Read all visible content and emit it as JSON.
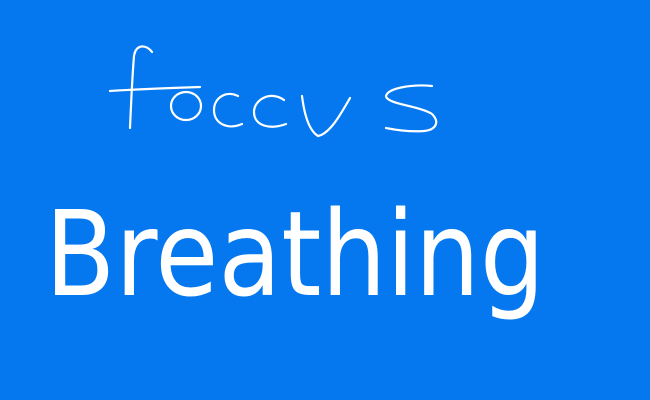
{
  "background_color": "#0578f0",
  "ink_color": "#ffffff",
  "handwriting": {
    "line1": "focus",
    "line2": "Breathing"
  }
}
